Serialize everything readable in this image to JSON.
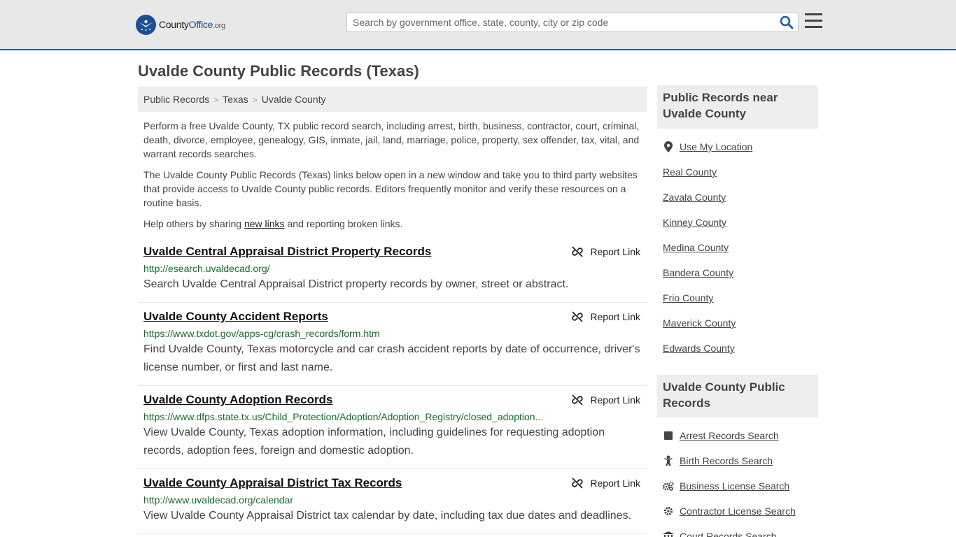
{
  "header": {
    "logo_county": "County",
    "logo_office": "Office",
    "logo_org": ".org",
    "search_placeholder": "Search by government office, state, county, city or zip code"
  },
  "page_title": "Uvalde County Public Records (Texas)",
  "breadcrumb": [
    "Public Records",
    "Texas",
    "Uvalde County"
  ],
  "intro": {
    "p1": "Perform a free Uvalde County, TX public record search, including arrest, birth, business, contractor, court, criminal, death, divorce, employee, genealogy, GIS, inmate, jail, land, marriage, police, property, sex offender, tax, vital, and warrant records searches.",
    "p2": "The Uvalde County Public Records (Texas) links below open in a new window and take you to third party websites that provide access to Uvalde County public records. Editors frequently monitor and verify these resources on a routine basis.",
    "p3_before": "Help others by sharing ",
    "p3_link": "new links",
    "p3_after": " and reporting broken links."
  },
  "report_label": "Report Link",
  "records": [
    {
      "title": "Uvalde Central Appraisal District Property Records",
      "url": "http://esearch.uvaldecad.org/",
      "desc": "Search Uvalde Central Appraisal District property records by owner, street or abstract."
    },
    {
      "title": "Uvalde County Accident Reports",
      "url": "https://www.txdot.gov/apps-cg/crash_records/form.htm",
      "desc": "Find Uvalde County, Texas motorcycle and car crash accident reports by date of occurrence, driver's license number, or first and last name."
    },
    {
      "title": "Uvalde County Adoption Records",
      "url": "https://www.dfps.state.tx.us/Child_Protection/Adoption/Adoption_Registry/closed_adoption...",
      "desc": "View Uvalde County, Texas adoption information, including guidelines for requesting adoption records, adoption fees, foreign and domestic adoption."
    },
    {
      "title": "Uvalde County Appraisal District Tax Records",
      "url": "http://www.uvaldecad.org/calendar",
      "desc": "View Uvalde County Appraisal District tax calendar by date, including tax due dates and deadlines."
    }
  ],
  "sidebar": {
    "near_title": "Public Records near Uvalde County",
    "near_items": [
      {
        "label": "Use My Location",
        "icon": "location-pin-icon"
      },
      {
        "label": "Real County"
      },
      {
        "label": "Zavala County"
      },
      {
        "label": "Kinney County"
      },
      {
        "label": "Medina County"
      },
      {
        "label": "Bandera County"
      },
      {
        "label": "Frio County"
      },
      {
        "label": "Maverick County"
      },
      {
        "label": "Edwards County"
      }
    ],
    "records_title": "Uvalde County Public Records",
    "records_items": [
      {
        "label": "Arrest Records Search",
        "icon": "square-icon"
      },
      {
        "label": "Birth Records Search",
        "icon": "baby-icon"
      },
      {
        "label": "Business License Search",
        "icon": "gears-icon"
      },
      {
        "label": "Contractor License Search",
        "icon": "gear-icon"
      },
      {
        "label": "Court Records Search",
        "icon": "courthouse-icon"
      }
    ]
  }
}
